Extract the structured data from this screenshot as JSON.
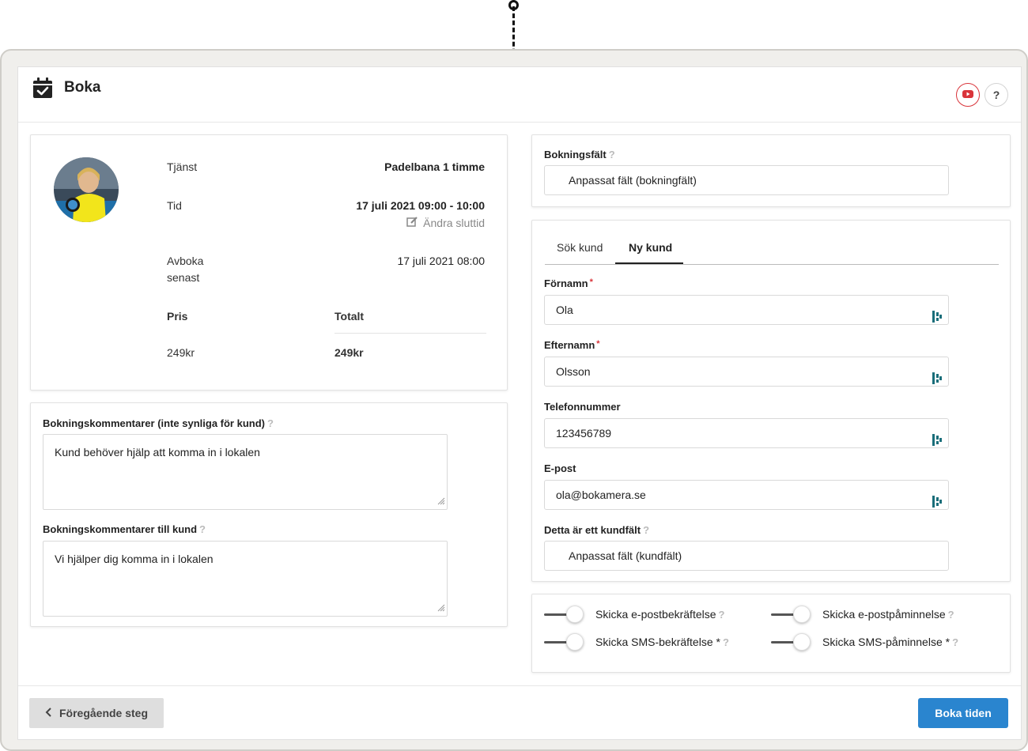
{
  "header": {
    "title": "Boka",
    "help_label": "?"
  },
  "summary": {
    "service_label": "Tjänst",
    "service_value": "Padelbana 1 timme",
    "time_label": "Tid",
    "time_value": "17 juli 2021 09:00 - 10:00",
    "change_end_label": "Ändra sluttid",
    "cancel_label_line1": "Avboka",
    "cancel_label_line2": "senast",
    "cancel_value": "17 juli 2021 08:00",
    "price_header": "Pris",
    "total_header": "Totalt",
    "price_value": "249kr",
    "total_value": "249kr"
  },
  "comments": {
    "internal_label": "Bokningskommentarer (inte synliga för kund)",
    "internal_value": "Kund behöver hjälp att komma in i lokalen",
    "customer_label": "Bokningskommentarer till kund",
    "customer_value": "Vi hjälper dig komma in i lokalen"
  },
  "booking_fields": {
    "label": "Bokningsfält",
    "value": "Anpassat fält (bokningfält)"
  },
  "customer": {
    "tabs": [
      "Sök kund",
      "Ny kund"
    ],
    "active_tab": "Ny kund",
    "firstname_label": "Förnamn",
    "firstname_value": "Ola",
    "lastname_label": "Efternamn",
    "lastname_value": "Olsson",
    "phone_label": "Telefonnummer",
    "phone_value": "123456789",
    "email_label": "E-post",
    "email_value": "ola@bokamera.se",
    "custom_label": "Detta är ett kundfält",
    "custom_value": "Anpassat fält (kundfält)",
    "required_mark": "*",
    "help_mark": "?"
  },
  "notifications": {
    "email_confirm": "Skicka e-postbekräftelse",
    "email_reminder": "Skicka e-postpåminnelse",
    "sms_confirm": "Skicka SMS-bekräftelse *",
    "sms_reminder": "Skicka SMS-påminnelse *"
  },
  "footer": {
    "prev_label": "Föregående steg",
    "book_label": "Boka tiden"
  },
  "colors": {
    "primary": "#2a85cf",
    "youtube": "#d9343a",
    "field_icon": "#1a6e7a"
  }
}
